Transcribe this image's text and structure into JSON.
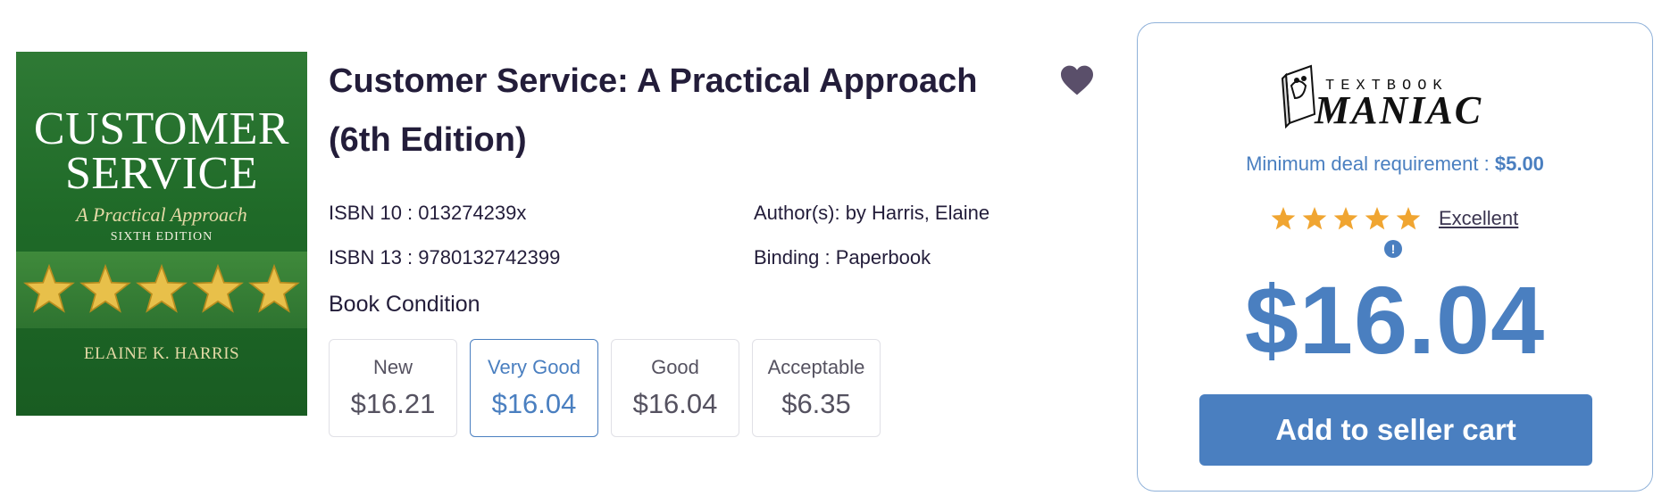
{
  "cover": {
    "title_line1": "CUSTOMER",
    "title_line2": "SERVICE",
    "subtitle": "A Practical Approach",
    "edition": "SIXTH EDITION",
    "author": "ELAINE K. HARRIS",
    "star_count": 5
  },
  "book": {
    "title": "Customer Service: A Practical Approach (6th Edition)",
    "isbn10": "ISBN 10 : 013274239x",
    "isbn13": "ISBN 13 : 9780132742399",
    "author": "Author(s): by Harris, Elaine",
    "binding": "Binding : Paperbook",
    "condition_label": "Book Condition"
  },
  "conditions": [
    {
      "name": "New",
      "price": "$16.21",
      "selected": false
    },
    {
      "name": "Very Good",
      "price": "$16.04",
      "selected": true
    },
    {
      "name": "Good",
      "price": "$16.04",
      "selected": false
    },
    {
      "name": "Acceptable",
      "price": "$6.35",
      "selected": false
    }
  ],
  "seller": {
    "logo_text_top": "TEXTBOOK",
    "logo_text_main": "MANIAC",
    "min_deal_label": "Minimum deal requirement :",
    "min_deal_value": "$5.00",
    "rating_stars": 5,
    "rating_label": "Excellent",
    "alert_symbol": "!",
    "price": "$16.04",
    "add_button": "Add to seller cart"
  },
  "colors": {
    "accent": "#4a7fc0",
    "text": "#231d3a",
    "star": "#f0a531",
    "heart": "#5a4f6a",
    "cover_green": "#1f6a28"
  }
}
